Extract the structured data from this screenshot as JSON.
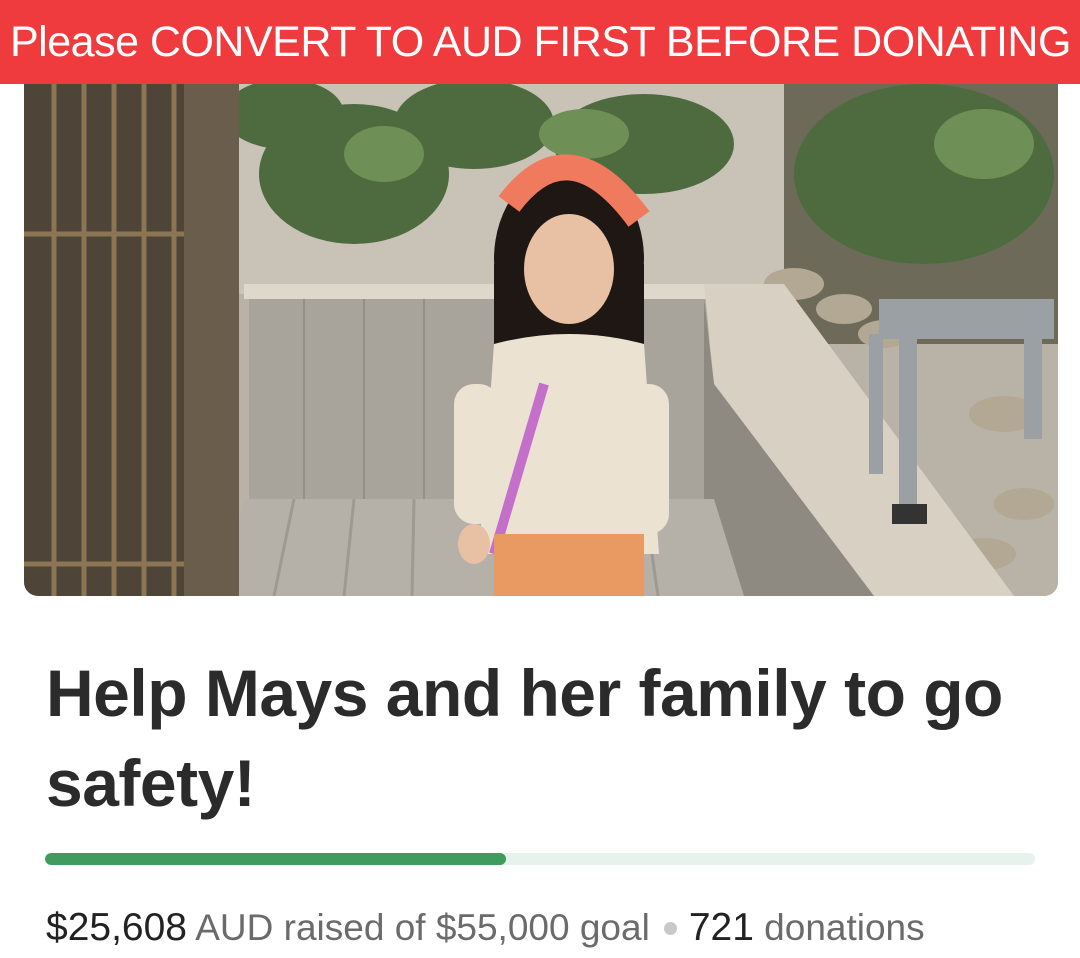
{
  "banner": {
    "text": "Please CONVERT TO AUD FIRST BEFORE DONATING",
    "color": "#ef3a3e"
  },
  "campaign": {
    "title": "Help Mays and her family to go safety!",
    "progress_fraction": 0.4656,
    "raised_amount": "$25,608",
    "raised_text": "AUD raised of $55,000 goal",
    "donation_count": "721",
    "donations_label": "donations"
  },
  "colors": {
    "progress_fill": "#3f9c5e",
    "progress_track": "#e5f3ec",
    "title_text": "#2b2b2b"
  }
}
